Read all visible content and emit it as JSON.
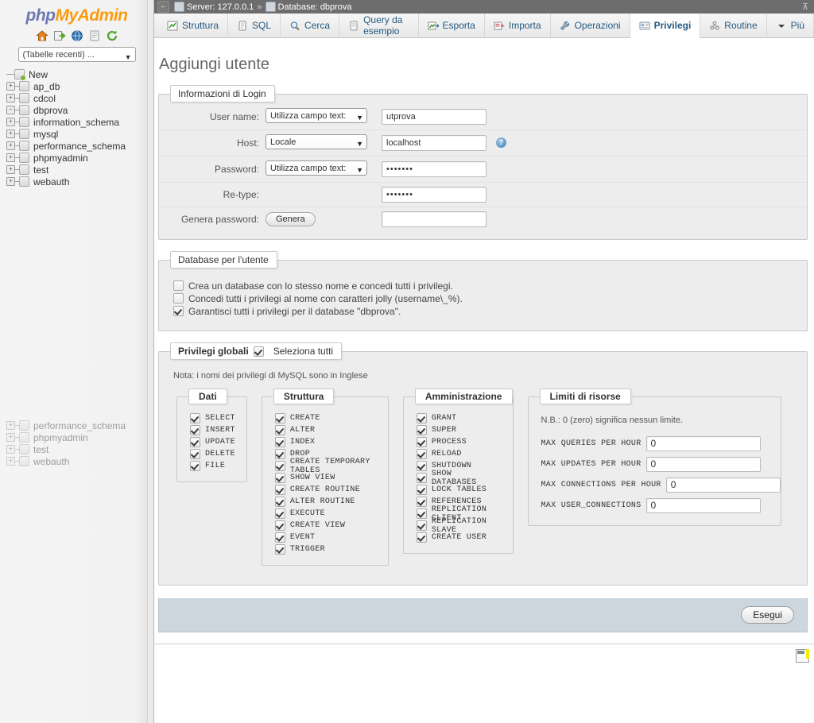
{
  "sidebar": {
    "logo": {
      "php": "php",
      "my": "My",
      "admin": "Admin"
    },
    "nav_icons": [
      {
        "name": "home-icon",
        "label": "Home"
      },
      {
        "name": "logout-icon",
        "label": "Esci"
      },
      {
        "name": "docs-globe-icon",
        "label": "Documentazione phpMyAdmin"
      },
      {
        "name": "mysql-docs-icon",
        "label": "Documentazione MySQL"
      },
      {
        "name": "refresh-icon",
        "label": "Ricarica"
      }
    ],
    "db_select": {
      "value": "(Tabelle recenti) ...",
      "arrow": "▼"
    },
    "tree": [
      {
        "label": "New",
        "toggle": "",
        "type": "new"
      },
      {
        "label": "ap_db",
        "toggle": "+",
        "type": "db"
      },
      {
        "label": "cdcol",
        "toggle": "+",
        "type": "db"
      },
      {
        "label": "dbprova",
        "toggle": "−",
        "type": "db"
      },
      {
        "label": "information_schema",
        "toggle": "+",
        "type": "db"
      },
      {
        "label": "mysql",
        "toggle": "+",
        "type": "db"
      },
      {
        "label": "performance_schema",
        "toggle": "+",
        "type": "db"
      },
      {
        "label": "phpmyadmin",
        "toggle": "+",
        "type": "db"
      },
      {
        "label": "test",
        "toggle": "+",
        "type": "db"
      },
      {
        "label": "webauth",
        "toggle": "+",
        "type": "db"
      }
    ],
    "tree_stub": [
      {
        "label": "performance_schema",
        "toggle": "+",
        "type": "db"
      },
      {
        "label": "phpmyadmin",
        "toggle": "+",
        "type": "db"
      },
      {
        "label": "test",
        "toggle": "+",
        "type": "db"
      },
      {
        "label": "webauth",
        "toggle": "+",
        "type": "db"
      }
    ]
  },
  "breadcrumb": {
    "back": "←",
    "server_label": "Server: 127.0.0.1",
    "separator": "»",
    "database_label": "Database: dbprova",
    "collapse": "⊼"
  },
  "tabs": [
    {
      "label": "Struttura",
      "icon": "structure-icon",
      "active": false
    },
    {
      "label": "SQL",
      "icon": "sql-icon",
      "active": false
    },
    {
      "label": "Cerca",
      "icon": "search-icon",
      "active": false
    },
    {
      "label": "Query da esempio",
      "icon": "query-icon",
      "active": false
    },
    {
      "label": "Esporta",
      "icon": "export-icon",
      "active": false
    },
    {
      "label": "Importa",
      "icon": "import-icon",
      "active": false
    },
    {
      "label": "Operazioni",
      "icon": "wrench-icon",
      "active": false
    },
    {
      "label": "Privilegi",
      "icon": "privileges-icon",
      "active": true
    },
    {
      "label": "Routine",
      "icon": "routine-icon",
      "active": false
    },
    {
      "label": "Più",
      "icon": "chevron-down-icon",
      "active": false
    }
  ],
  "page": {
    "title": "Aggiungi utente"
  },
  "login": {
    "legend": "Informazioni di Login",
    "rows": [
      {
        "label": "User name:",
        "select": "Utilizza campo text:",
        "value": "utprova",
        "has_select": true,
        "has_input": true,
        "help": false
      },
      {
        "label": "Host:",
        "select": "Locale",
        "value": "localhost",
        "has_select": true,
        "has_input": true,
        "help": true
      },
      {
        "label": "Password:",
        "select": "Utilizza campo text:",
        "value": "•••••••",
        "has_select": true,
        "has_input": true,
        "help": false
      },
      {
        "label": "Re-type:",
        "select": "",
        "value": "•••••••",
        "has_select": false,
        "has_input": true,
        "help": false
      },
      {
        "label": "Genera password:",
        "select": "",
        "value": "",
        "has_select": false,
        "has_input": true,
        "help": false,
        "button": "Genera"
      }
    ],
    "select_arrow": "▼",
    "help_glyph": "?"
  },
  "db_for_user": {
    "legend": "Database per l'utente",
    "options": [
      {
        "label": "Crea un database con lo stesso nome e concedi tutti i privilegi.",
        "checked": false
      },
      {
        "label": "Concedi tutti i privilegi al nome con caratteri jolly (username\\_%).",
        "checked": false
      },
      {
        "label": "Garantisci tutti i privilegi per il database \"dbprova\".",
        "checked": true
      }
    ]
  },
  "global_privileges": {
    "legend": "Privilegi globali",
    "select_all_label": "Seleziona tutti",
    "select_all_checked": true,
    "note": "Nota: i nomi dei privilegi di MySQL sono in Inglese",
    "groups": [
      {
        "title": "Dati",
        "items": [
          {
            "name": "SELECT",
            "checked": true
          },
          {
            "name": "INSERT",
            "checked": true
          },
          {
            "name": "UPDATE",
            "checked": true
          },
          {
            "name": "DELETE",
            "checked": true
          },
          {
            "name": "FILE",
            "checked": true
          }
        ]
      },
      {
        "title": "Struttura",
        "items": [
          {
            "name": "CREATE",
            "checked": true
          },
          {
            "name": "ALTER",
            "checked": true
          },
          {
            "name": "INDEX",
            "checked": true
          },
          {
            "name": "DROP",
            "checked": true
          },
          {
            "name": "CREATE TEMPORARY TABLES",
            "checked": true
          },
          {
            "name": "SHOW VIEW",
            "checked": true
          },
          {
            "name": "CREATE ROUTINE",
            "checked": true
          },
          {
            "name": "ALTER ROUTINE",
            "checked": true
          },
          {
            "name": "EXECUTE",
            "checked": true
          },
          {
            "name": "CREATE VIEW",
            "checked": true
          },
          {
            "name": "EVENT",
            "checked": true
          },
          {
            "name": "TRIGGER",
            "checked": true
          }
        ]
      },
      {
        "title": "Amministrazione",
        "items": [
          {
            "name": "GRANT",
            "checked": true
          },
          {
            "name": "SUPER",
            "checked": true
          },
          {
            "name": "PROCESS",
            "checked": true
          },
          {
            "name": "RELOAD",
            "checked": true
          },
          {
            "name": "SHUTDOWN",
            "checked": true
          },
          {
            "name": "SHOW DATABASES",
            "checked": true
          },
          {
            "name": "LOCK TABLES",
            "checked": true
          },
          {
            "name": "REFERENCES",
            "checked": true
          },
          {
            "name": "REPLICATION CLIENT",
            "checked": true
          },
          {
            "name": "REPLICATION SLAVE",
            "checked": true
          },
          {
            "name": "CREATE USER",
            "checked": true
          }
        ]
      }
    ],
    "resource_limits": {
      "title": "Limiti di risorse",
      "note": "N.B.: 0 (zero) significa nessun limite.",
      "fields": [
        {
          "name": "MAX QUERIES PER HOUR",
          "value": "0",
          "input_width": 144
        },
        {
          "name": "MAX UPDATES PER HOUR",
          "value": "0",
          "input_width": 144
        },
        {
          "name": "MAX CONNECTIONS PER HOUR",
          "value": "0",
          "input_width": 144
        },
        {
          "name": "MAX USER_CONNECTIONS",
          "value": "0",
          "input_width": 144
        }
      ]
    }
  },
  "footer": {
    "submit_label": "Esegui",
    "console_icon": "console-icon"
  },
  "colors": {
    "breadcrumb_bg": "#6d6d6d",
    "tab_link": "#235a81",
    "fieldset_bg": "#ededed",
    "submit_bar_bg": "#ccd6df",
    "logo_blue": "#6c78af",
    "logo_orange": "#f89c0e"
  }
}
